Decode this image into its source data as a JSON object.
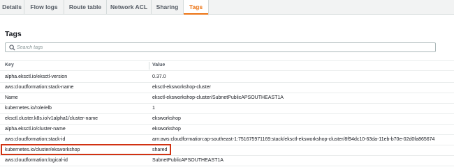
{
  "tabs": [
    "Details",
    "Flow logs",
    "Route table",
    "Network ACL",
    "Sharing",
    "Tags"
  ],
  "active_tab": "Tags",
  "section": {
    "title": "Tags"
  },
  "search": {
    "placeholder": "Search tags",
    "value": ""
  },
  "table": {
    "headers": {
      "key": "Key",
      "value": "Value"
    },
    "rows": [
      {
        "key": "alpha.eksctl.io/eksctl-version",
        "value": "0.37.0"
      },
      {
        "key": "aws:cloudformation:stack-name",
        "value": "eksctl-eksworkshop-cluster"
      },
      {
        "key": "Name",
        "value": "eksctl-eksworkshop-cluster/SubnetPublicAPSOUTHEAST1A"
      },
      {
        "key": "kubernetes.io/role/elb",
        "value": "1"
      },
      {
        "key": "eksctl.cluster.k8s.io/v1alpha1/cluster-name",
        "value": "eksworkshop"
      },
      {
        "key": "alpha.eksctl.io/cluster-name",
        "value": "eksworkshop"
      },
      {
        "key": "aws:cloudformation:stack-id",
        "value": "arn:aws:cloudformation:ap-southeast-1:751675971169:stack/eksctl-eksworkshop-cluster/8f94dc10-63da-11eb-b70e-02d0fa865674"
      },
      {
        "key": "kubernetes.io/cluster/eksworkshop",
        "value": "shared"
      },
      {
        "key": "aws:cloudformation:logical-id",
        "value": "SubnetPublicAPSOUTHEAST1A"
      }
    ],
    "highlighted_row": 7
  },
  "colors": {
    "accent": "#ec7211",
    "highlight_border": "#d13212"
  },
  "icons": {
    "search": "search-icon"
  }
}
